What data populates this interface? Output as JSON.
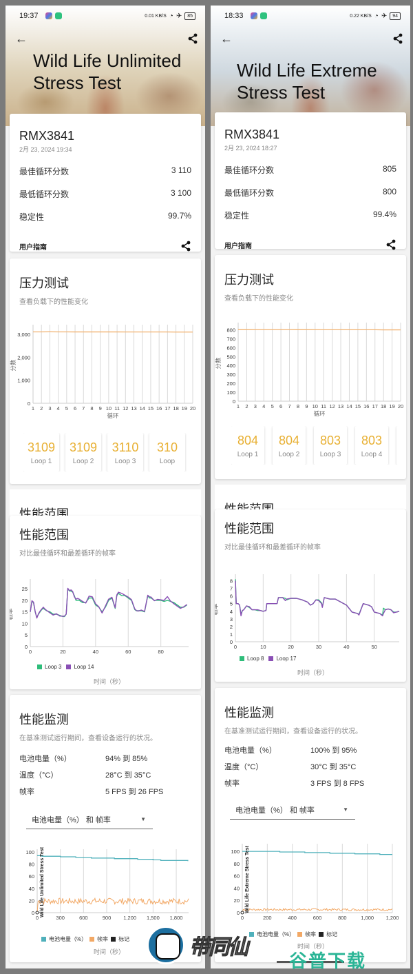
{
  "screens": [
    {
      "status": {
        "time": "19:37",
        "speed": "0.01 KB/S",
        "battery": "85"
      },
      "title": "Wild Life Unlimited Stress Test",
      "summary": {
        "device": "RMX3841",
        "date": "2月 23, 2024 19:34",
        "rows": [
          {
            "label": "最佳循环分数",
            "value": "3 110"
          },
          {
            "label": "最低循环分数",
            "value": "3 100"
          },
          {
            "label": "稳定性",
            "value": "99.7%"
          }
        ],
        "guide": "用户指南"
      },
      "stress": {
        "title": "压力测试",
        "subtitle": "查看负载下的性能变化",
        "loops": [
          {
            "value": "3109",
            "label": "Loop 1"
          },
          {
            "value": "3109",
            "label": "Loop 2"
          },
          {
            "value": "3110",
            "label": "Loop 3"
          },
          {
            "value": "310",
            "label": "Loop"
          }
        ]
      },
      "range": {
        "ghost_title": "性能范围",
        "title": "性能范围",
        "subtitle": "对比最佳循环和最差循环的帧率",
        "legend": [
          {
            "label": "Loop 3",
            "color": "#2ebd7a"
          },
          {
            "label": "Loop 14",
            "color": "#8a4fb5"
          }
        ],
        "xlabel": "时间（秒）"
      },
      "monitor": {
        "title": "性能监测",
        "subtitle": "在基准测试运行期间，查看设备运行的状况。",
        "rows": [
          {
            "label": "电池电量（%）",
            "value": "94% 到 85%"
          },
          {
            "label": "温度（°C）",
            "value": "28°C 到 35°C"
          },
          {
            "label": "帧率",
            "value": "5 FPS 到 26 FPS"
          }
        ],
        "dropdown": "电池电量（%） 和 帧率",
        "legend": [
          {
            "label": "电池电量（%）",
            "color": "#4fb0bb"
          },
          {
            "label": "帧率",
            "color": "#f2a865"
          },
          {
            "label": "标记",
            "color": "#222222"
          }
        ],
        "xlabel": "时间（秒）",
        "vertical_label": "Wild Life Unlimited Stress Test"
      }
    },
    {
      "status": {
        "time": "18:33",
        "speed": "0.22 KB/S",
        "battery": "94"
      },
      "title": "Wild Life Extreme Stress Test",
      "summary": {
        "device": "RMX3841",
        "date": "2月 23, 2024 18:27",
        "rows": [
          {
            "label": "最佳循环分数",
            "value": "805"
          },
          {
            "label": "最低循环分数",
            "value": "800"
          },
          {
            "label": "稳定性",
            "value": "99.4%"
          }
        ],
        "guide": "用户指南"
      },
      "stress": {
        "title": "压力测试",
        "subtitle": "查看负载下的性能变化",
        "loops": [
          {
            "value": "804",
            "label": "Loop 1"
          },
          {
            "value": "804",
            "label": "Loop 2"
          },
          {
            "value": "803",
            "label": "Loop 3"
          },
          {
            "value": "803",
            "label": "Loop 4"
          }
        ]
      },
      "range": {
        "ghost_title": "性能范围",
        "title": "性能范围",
        "subtitle": "对比最佳循环和最差循环的帧率",
        "legend": [
          {
            "label": "Loop 8",
            "color": "#2ebd7a"
          },
          {
            "label": "Loop 17",
            "color": "#8a4fb5"
          }
        ],
        "xlabel": "时间（秒）"
      },
      "monitor": {
        "title": "性能监测",
        "subtitle": "在基准测试运行期间，查看设备运行的状况。",
        "rows": [
          {
            "label": "电池电量（%）",
            "value": "100% 到 95%"
          },
          {
            "label": "温度（°C）",
            "value": "30°C 到 35°C"
          },
          {
            "label": "帧率",
            "value": "3 FPS 到 8 FPS"
          }
        ],
        "dropdown": "电池电量（%） 和 帧率",
        "legend": [
          {
            "label": "电池电量（%）",
            "color": "#4fb0bb"
          },
          {
            "label": "帧率",
            "color": "#f2a865"
          },
          {
            "label": "标记",
            "color": "#222222"
          }
        ],
        "xlabel": "时间（秒）",
        "vertical_label": "Wild Life Extreme Stress Test"
      }
    }
  ],
  "watermarks": {
    "left": "带同仙",
    "right": "谷普下载"
  },
  "chart_data": [
    {
      "id": "stress-1",
      "type": "line",
      "title": "压力测试",
      "xlabel": "循环",
      "ylabel": "分数",
      "x": [
        1,
        2,
        3,
        4,
        5,
        6,
        7,
        8,
        9,
        10,
        11,
        12,
        13,
        14,
        15,
        16,
        17,
        18,
        19,
        20
      ],
      "series": [
        {
          "name": "score",
          "color": "#f2b77a",
          "values": [
            3109,
            3109,
            3110,
            3108,
            3107,
            3106,
            3106,
            3105,
            3105,
            3104,
            3104,
            3103,
            3103,
            3102,
            3102,
            3101,
            3101,
            3100,
            3100,
            3100
          ]
        }
      ],
      "xlim": [
        1,
        20
      ],
      "ylim": [
        0,
        3300
      ],
      "yticks": [
        0,
        1000,
        2000,
        3000
      ],
      "ytick_labels": [
        "0",
        "1,000",
        "2,000",
        "3,000"
      ],
      "grid": "vertical"
    },
    {
      "id": "stress-2",
      "type": "line",
      "title": "压力测试",
      "xlabel": "循环",
      "ylabel": "分数",
      "x": [
        1,
        2,
        3,
        4,
        5,
        6,
        7,
        8,
        9,
        10,
        11,
        12,
        13,
        14,
        15,
        16,
        17,
        18,
        19,
        20
      ],
      "series": [
        {
          "name": "score",
          "color": "#f2b77a",
          "values": [
            804,
            804,
            803,
            803,
            803,
            803,
            803,
            804,
            804,
            803,
            802,
            802,
            802,
            801,
            801,
            801,
            801,
            800,
            800,
            800
          ]
        }
      ],
      "xlim": [
        1,
        20
      ],
      "ylim": [
        0,
        850
      ],
      "yticks": [
        0,
        100,
        200,
        300,
        400,
        500,
        600,
        700,
        800
      ],
      "ytick_labels": [
        "0",
        "100",
        "200",
        "300",
        "400",
        "500",
        "600",
        "700",
        "800"
      ],
      "grid": "vertical"
    },
    {
      "id": "range-1",
      "type": "line",
      "title": "性能范围",
      "xlabel": "时间（秒）",
      "ylabel": "帧率",
      "x": [
        0,
        1,
        2,
        3,
        4,
        5,
        6,
        7,
        8,
        9,
        10,
        12,
        14,
        16,
        18,
        20,
        21,
        22,
        23,
        24,
        25,
        26,
        27,
        28,
        29,
        30,
        32,
        34,
        36,
        38,
        40,
        42,
        44,
        46,
        48,
        50,
        52,
        53,
        54,
        56,
        58,
        60,
        62,
        64,
        65,
        66,
        68,
        70,
        72,
        73,
        74,
        76,
        78,
        80,
        82,
        84,
        86,
        88,
        90,
        92,
        94,
        96
      ],
      "series": [
        {
          "name": "Loop 3",
          "color": "#2ebd7a",
          "values": [
            15,
            19.5,
            19,
            15,
            12.5,
            14,
            15,
            16,
            16.5,
            16,
            15.5,
            15,
            14,
            14,
            13.5,
            13,
            13,
            14,
            25,
            24,
            24,
            23.5,
            22,
            20,
            20,
            20,
            19,
            19,
            21,
            21,
            18,
            17,
            15,
            17,
            20,
            21,
            16.5,
            22,
            23,
            22,
            22,
            21,
            20,
            16,
            15.5,
            15.5,
            15.5,
            15,
            22,
            21,
            21,
            20,
            20,
            20,
            19.5,
            20,
            19.5,
            19,
            18,
            17,
            17,
            18
          ]
        },
        {
          "name": "Loop 14",
          "color": "#8a4fb5",
          "values": [
            15,
            19.8,
            19.2,
            15.2,
            12.3,
            14.2,
            15.3,
            16.2,
            17,
            16.2,
            15.6,
            14.6,
            13.6,
            14.2,
            13.2,
            13.1,
            13.2,
            14.1,
            25.2,
            24.2,
            24.5,
            23.8,
            21.5,
            20.5,
            20.8,
            20.5,
            19.5,
            18.8,
            21.8,
            21.5,
            18.5,
            17.2,
            14.5,
            17.5,
            20.5,
            21.3,
            16.8,
            22.3,
            23.5,
            23,
            22.2,
            21.4,
            20.3,
            16.3,
            15.6,
            15.3,
            15.8,
            15.2,
            22.2,
            21.5,
            21.4,
            19.8,
            20.4,
            20.2,
            20,
            21.6,
            19.6,
            18.5,
            17.5,
            16.5,
            17.2,
            18.2
          ]
        }
      ],
      "xlim": [
        0,
        97
      ],
      "ylim": [
        0,
        28
      ],
      "xticks": [
        0,
        20,
        40,
        60,
        80
      ],
      "yticks": [
        0,
        5,
        10,
        15,
        20,
        25
      ],
      "legend": "bottom-left",
      "grid": "vertical"
    },
    {
      "id": "range-2",
      "type": "line",
      "title": "性能范围",
      "xlabel": "时间（秒）",
      "ylabel": "帧率",
      "x": [
        0,
        0.3,
        1,
        1.5,
        2,
        2.5,
        3,
        4,
        5,
        6,
        7,
        8,
        9,
        10,
        11,
        11.3,
        12,
        14,
        15,
        15.5,
        17,
        18,
        18.5,
        20,
        22,
        24,
        26,
        27,
        28,
        29,
        30,
        31,
        31.3,
        32,
        34,
        36,
        38,
        40,
        42,
        44,
        44.5,
        46,
        48,
        49,
        50,
        52,
        53,
        53.3,
        54,
        55,
        56,
        57,
        58,
        59
      ],
      "series": [
        {
          "name": "Loop 8",
          "color": "#2ebd7a",
          "values": [
            8.2,
            5,
            5,
            4.8,
            3.6,
            4.1,
            4.2,
            4.7,
            4.5,
            4.2,
            4.2,
            4.1,
            4.1,
            4.0,
            4.1,
            5,
            5,
            5,
            5,
            5.8,
            5.8,
            5.7,
            5.5,
            5.7,
            5.7,
            5.5,
            5.2,
            4.8,
            5,
            5.5,
            5.5,
            5.1,
            4.6,
            5.8,
            5.6,
            5.6,
            5.2,
            4.8,
            3.9,
            3.7,
            3.6,
            5,
            4.8,
            4.6,
            3.9,
            3.7,
            3.5,
            4.4,
            4.2,
            4.3,
            4.2,
            3.9,
            3.9,
            4
          ]
        },
        {
          "name": "Loop 17",
          "color": "#8a4fb5",
          "values": [
            8,
            5,
            5,
            4.8,
            3.4,
            4.1,
            4.2,
            4.7,
            4.6,
            4.2,
            4.2,
            4.2,
            4.1,
            4.0,
            4.1,
            5,
            5,
            5,
            5,
            5.8,
            5.8,
            5.4,
            5.6,
            5.7,
            5.7,
            5.5,
            5.2,
            4.8,
            5,
            5.5,
            5.4,
            5.0,
            4.5,
            5.8,
            5.6,
            5.6,
            5.2,
            4.8,
            3.9,
            3.7,
            3.5,
            5,
            4.8,
            4.6,
            3.9,
            3.7,
            3.4,
            3.7,
            4.2,
            4.3,
            4.2,
            3.8,
            3.9,
            4
          ]
        }
      ],
      "xlim": [
        0,
        59
      ],
      "ylim": [
        0,
        8.5
      ],
      "xticks": [
        0,
        10,
        20,
        30,
        40,
        50
      ],
      "yticks": [
        0,
        1,
        2,
        3,
        4,
        5,
        6,
        7,
        8
      ],
      "legend": "bottom-left",
      "grid": "vertical"
    },
    {
      "id": "monitor-1",
      "type": "line",
      "title": "电池电量（%） 和 帧率",
      "xlabel": "时间（秒）",
      "ylabel": "",
      "series": [
        {
          "name": "电池电量（%）",
          "color": "#4fb0bb",
          "x": [
            0,
            60,
            200,
            300,
            500,
            700,
            900,
            1000,
            1200,
            1300,
            1500,
            1600,
            1750,
            1950
          ],
          "values": [
            94,
            93,
            93,
            92,
            91,
            90,
            90,
            89,
            89,
            88,
            87,
            86,
            86,
            85
          ]
        },
        {
          "name": "帧率",
          "color": "#f2a865",
          "x": "0..1950 (noisy)",
          "values": "oscillates ~13–25, mean ~19"
        },
        {
          "name": "标记",
          "color": "#222222",
          "x": [
            0
          ],
          "values": [
            0
          ]
        }
      ],
      "xlim": [
        0,
        1960
      ],
      "ylim": [
        0,
        100
      ],
      "xticks": [
        0,
        300,
        600,
        900,
        1200,
        1500,
        1800
      ],
      "xtick_labels": [
        "0",
        "300",
        "600",
        "900",
        "1,200",
        "1,500",
        "1,800"
      ],
      "yticks": [
        0,
        20,
        40,
        60,
        80,
        100
      ],
      "legend": "bottom",
      "grid": "vertical"
    },
    {
      "id": "monitor-2",
      "type": "line",
      "title": "电池电量（%） 和 帧率",
      "xlabel": "时间（秒）",
      "ylabel": "",
      "series": [
        {
          "name": "电池电量（%）",
          "color": "#4fb0bb",
          "x": [
            0,
            250,
            300,
            400,
            500,
            600,
            700,
            800,
            900,
            1000,
            1100,
            1200
          ],
          "values": [
            100,
            100,
            99,
            99,
            98,
            98,
            97,
            97,
            96,
            96,
            95,
            95
          ]
        },
        {
          "name": "帧率",
          "color": "#f2a865",
          "x": "0..1200 (noisy)",
          "values": "oscillates ~3–8, mean ~5"
        },
        {
          "name": "标记",
          "color": "#222222",
          "x": [
            0
          ],
          "values": [
            0
          ]
        }
      ],
      "xlim": [
        0,
        1200
      ],
      "ylim": [
        0,
        108
      ],
      "xticks": [
        0,
        200,
        400,
        600,
        800,
        1000,
        1200
      ],
      "xtick_labels": [
        "0",
        "200",
        "400",
        "600",
        "800",
        "1,000",
        "1,200"
      ],
      "yticks": [
        0,
        20,
        40,
        60,
        80,
        100
      ],
      "legend": "bottom",
      "grid": "vertical"
    }
  ]
}
